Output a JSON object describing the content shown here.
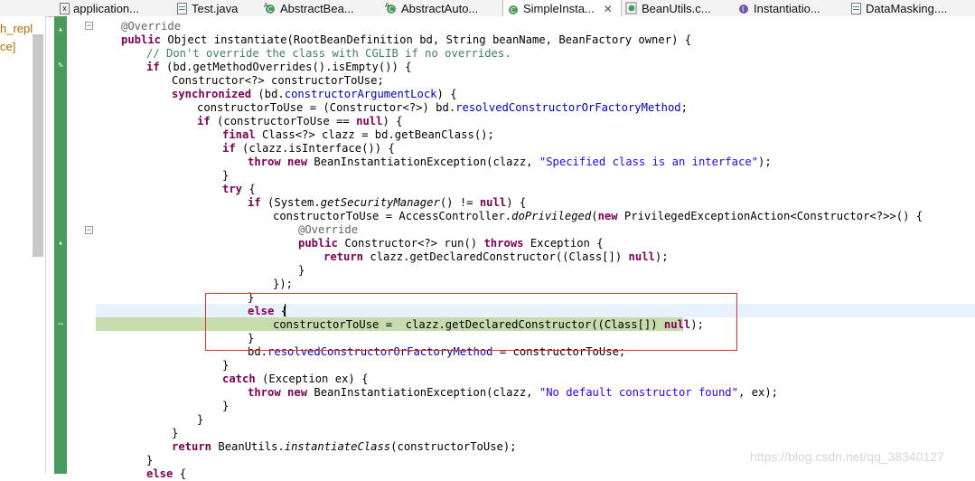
{
  "tabs": [
    {
      "label": "application...",
      "icon": "xml-file-icon",
      "active": false
    },
    {
      "label": "Test.java",
      "icon": "java-file-icon",
      "active": false
    },
    {
      "label": "AbstractBea...",
      "icon": "java-class-icon",
      "active": false
    },
    {
      "label": "AbstractAuto...",
      "icon": "java-class-icon",
      "active": false
    },
    {
      "label": "SimpleInsta...",
      "icon": "java-class-icon",
      "active": true,
      "close": "✕"
    },
    {
      "label": "BeanUtils.c...",
      "icon": "class-file-icon",
      "active": false
    },
    {
      "label": "Instantiatio...",
      "icon": "java-class-icon",
      "active": false
    },
    {
      "label": "DataMasking....",
      "icon": "java-file-icon",
      "active": false
    }
  ],
  "left_panel": {
    "line1": "h_repl",
    "line2": "ce]"
  },
  "code_lines": [
    "@Override",
    "public Object instantiate(RootBeanDefinition bd, String beanName, BeanFactory owner) {",
    "// Don't override the class with CGLIB if no overrides.",
    "if (bd.getMethodOverrides().isEmpty()) {",
    "Constructor<?> constructorToUse;",
    "synchronized (bd.constructorArgumentLock) {",
    "constructorToUse = (Constructor<?>) bd.resolvedConstructorOrFactoryMethod;",
    "if (constructorToUse == null) {",
    "final Class<?> clazz = bd.getBeanClass();",
    "if (clazz.isInterface()) {",
    "throw new BeanInstantiationException(clazz, \"Specified class is an interface\");",
    "}",
    "try {",
    "if (System.getSecurityManager() != null) {",
    "constructorToUse = AccessController.doPrivileged(new PrivilegedExceptionAction<Constructor<?>>() {",
    "@Override",
    "public Constructor<?> run() throws Exception {",
    "return clazz.getDeclaredConstructor((Class[]) null);",
    "}",
    "});",
    "}",
    "else {",
    "constructorToUse =  clazz.getDeclaredConstructor((Class[]) null);",
    "}",
    "bd.resolvedConstructorOrFactoryMethod = constructorToUse;",
    "}",
    "catch (Exception ex) {",
    "throw new BeanInstantiationException(clazz, \"No default constructor found\", ex);",
    "}",
    "}",
    "}",
    "return BeanUtils.instantiateClass(constructorToUse);",
    "}",
    "else {"
  ],
  "watermark": "https://blog.csdn.net/qq_38340127",
  "colors": {
    "keyword": "#7f0055",
    "field": "#0000c0",
    "comment": "#3f7f5f",
    "string": "#2a00ff",
    "annotation": "#646464",
    "debug_line": "#c6dbae",
    "current_line": "#e8f2fe",
    "highlight_box": "#e0322b"
  }
}
